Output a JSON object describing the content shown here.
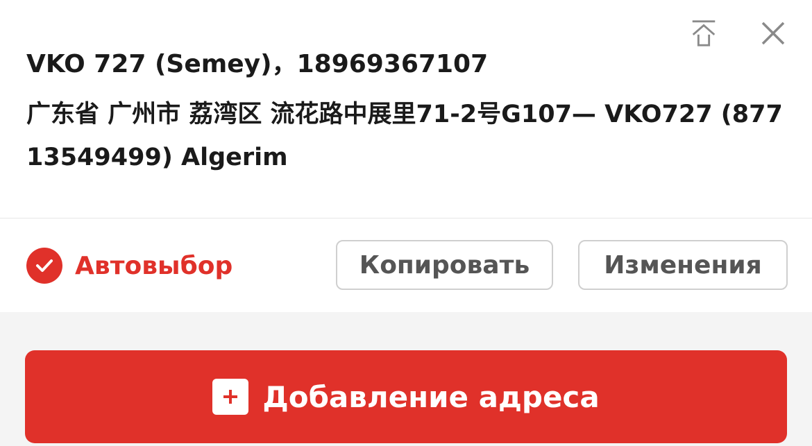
{
  "address_card": {
    "recipient": "VKO 727 (Semey)，18969367107",
    "address": "广东省 广州市 荔湾区 流花路中展里71-2号G107— VKO727 (87713549499) Algerim",
    "icons": {
      "pin_top": "pin-to-top-icon",
      "close": "close-icon"
    }
  },
  "actions": {
    "auto_select_label": "Автовыбор",
    "auto_select_checked": true,
    "copy_label": "Копировать",
    "edit_label": "Изменения"
  },
  "footer": {
    "add_address_label": "Добавление адреса",
    "add_icon": "plus-icon"
  },
  "colors": {
    "accent": "#e0312a",
    "text": "#1a1a1a",
    "button_text": "#555555",
    "background": "#f4f4f4"
  }
}
